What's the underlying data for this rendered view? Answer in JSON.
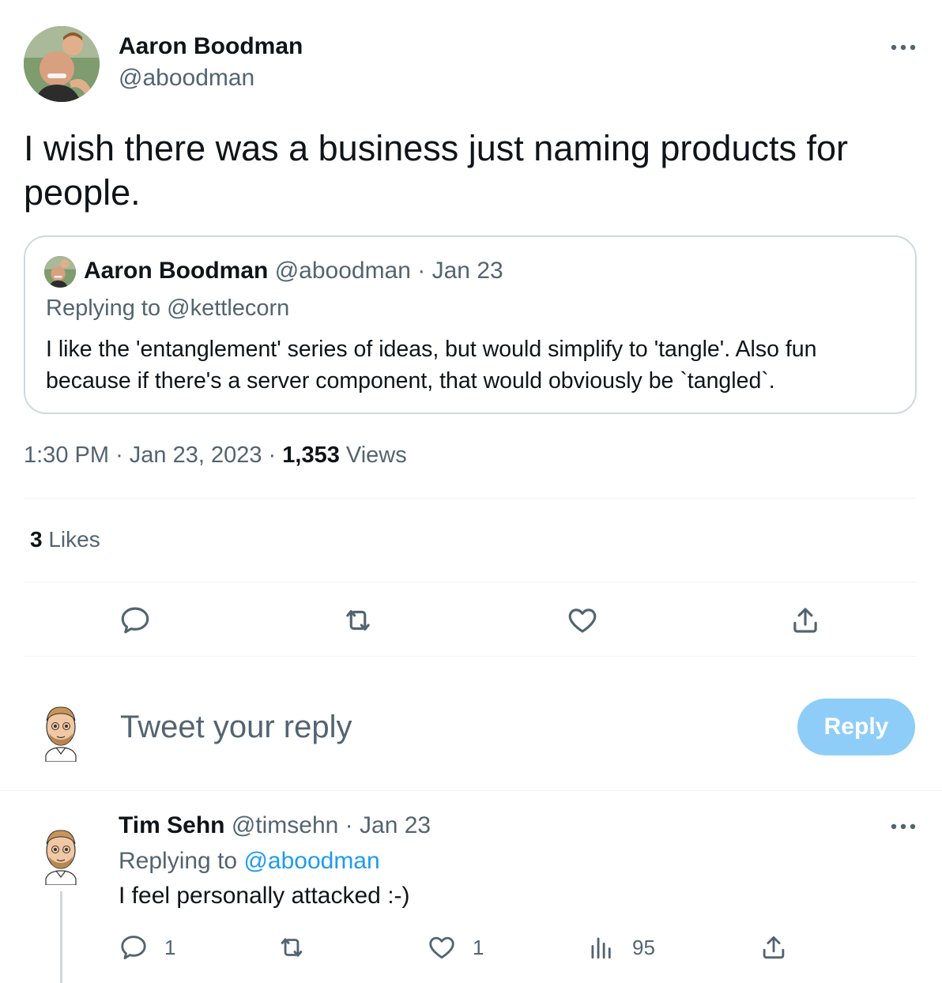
{
  "tweet": {
    "author_name": "Aaron Boodman",
    "author_handle": "@aboodman",
    "text": "I wish there was a business just naming products for people.",
    "time": "1:30 PM",
    "date": "Jan 23, 2023",
    "views_count": "1,353",
    "views_label": "Views",
    "likes_count": "3",
    "likes_label": "Likes"
  },
  "quote": {
    "author_name": "Aaron Boodman",
    "author_handle": "@aboodman",
    "date": "Jan 23",
    "replying_to": "Replying to @kettlecorn",
    "text": "I like the 'entanglement' series of ideas, but would simplify to 'tangle'. Also fun because if there's a server component, that would obviously be `tangled`."
  },
  "actions": {
    "reply_icon": "comment-icon",
    "retweet_icon": "retweet-icon",
    "like_icon": "heart-icon",
    "share_icon": "share-icon"
  },
  "composer": {
    "placeholder": "Tweet your reply",
    "button_label": "Reply"
  },
  "reply": {
    "author_name": "Tim Sehn",
    "author_handle": "@timsehn",
    "date": "Jan 23",
    "replying_prefix": "Replying to",
    "replying_handle": "@aboodman",
    "text": "I feel personally attacked :-)",
    "reply_count": "1",
    "like_count": "1",
    "views_count": "95"
  },
  "colors": {
    "accent": "#1d9bf0",
    "reply_button": "#8ecdf8",
    "muted_text": "#536471",
    "divider": "#eff3f4"
  }
}
